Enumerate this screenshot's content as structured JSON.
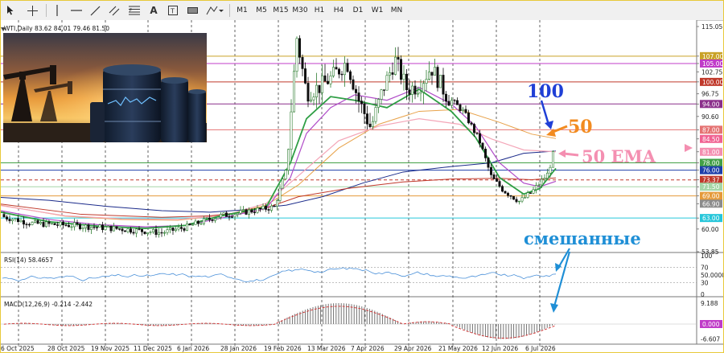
{
  "toolbar": {
    "tools": [
      "cursor-icon",
      "crosshair-icon",
      "horizontal-line-icon",
      "trendline-icon",
      "equidistant-channel-icon",
      "fibonacci-icon",
      "text-icon",
      "label-icon",
      "rectangle-icon",
      "shapes-icon"
    ],
    "timeframes": [
      "M1",
      "M5",
      "M15",
      "M30",
      "H1",
      "H4",
      "D1",
      "W1",
      "MN"
    ]
  },
  "chart_header": "WTI,Daily  83.62 84.01 79.46 81.50",
  "main_axis": {
    "ticks": [
      "115.05",
      "107.00",
      "105.00",
      "102.75",
      "100.00",
      "96.75",
      "94.00",
      "90.60",
      "87.00",
      "84.50",
      "81.00",
      "78.00",
      "76.00",
      "73.37",
      "71.50",
      "69.00",
      "66.90",
      "63.00",
      "60.00",
      "53.85"
    ],
    "tag_colors": {
      "107.00": "#c9a227",
      "105.00": "#c03cc8",
      "100.00": "#c0392b",
      "94.00": "#8b2f8b",
      "87.00": "#e57373",
      "84.50": "#f06292",
      "81.00": "#f48fb1",
      "78.00": "#43a047",
      "76.00": "#1e3faa",
      "73.37": "#c0392b",
      "71.50": "#a5d6a7",
      "69.00": "#e59a3a",
      "66.90": "#8c8c8c",
      "63.00": "#26c6da"
    }
  },
  "rsi": {
    "label": "RSI(14) 58.4657",
    "ticks": [
      "100",
      "70",
      "50.0000",
      "30",
      "0"
    ]
  },
  "macd": {
    "label": "MACD(12,26,9) -0.214 -2.442",
    "ticks": [
      "9.188",
      "0.000",
      "-6.607"
    ]
  },
  "dates": [
    "6 Oct 2025",
    "28 Oct 2025",
    "19 Nov 2025",
    "11 Dec 2025",
    "6 Jan 2026",
    "28 Jan 2026",
    "19 Feb 2026",
    "13 Mar 2026",
    "7 Apr 2026",
    "29 Apr 2026",
    "21 May 2026",
    "12 Jun 2026",
    "6 Jul 2026"
  ],
  "annotations": {
    "label_100": "100",
    "label_50": "50",
    "label_50ema": "50 EMA",
    "label_mixed": "смешанные"
  },
  "colors": {
    "candle_bull": "#2e7d32",
    "candle_bear": "#111111",
    "ma100": "#1a2a8a",
    "ma50": "#e8a24a",
    "ema50": "#f4a6b8",
    "ma_fast": "#2e9e44",
    "ma_mid": "#b04cc8",
    "ma_slow": "#c0392b",
    "rsi_line": "#4a90d9",
    "annot_blue": "#1f3fd6",
    "annot_orange": "#f28b20",
    "annot_pink": "#f48fb1"
  }
}
